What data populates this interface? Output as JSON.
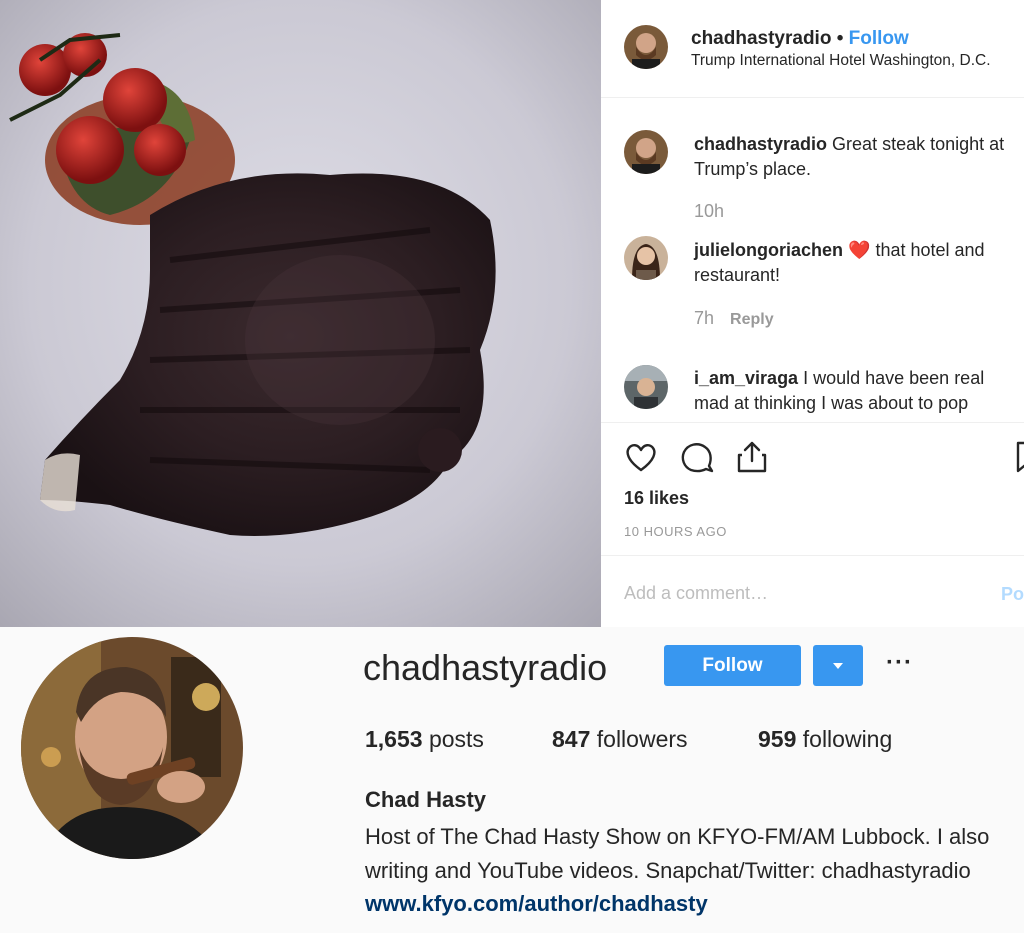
{
  "post": {
    "header": {
      "username": "chadhastyradio",
      "separator": " • ",
      "follow_label": "Follow",
      "location": "Trump International Hotel Washington, D.C."
    },
    "comments": [
      {
        "username": "chadhastyradio",
        "text": " Great steak tonight at Trump’s place.",
        "time": "10h",
        "reply_label": ""
      },
      {
        "username": "julielongoriachen",
        "text": " that hotel and restaurant!",
        "emoji": "❤️",
        "time": "7h",
        "reply_label": "Reply"
      },
      {
        "username": "i_am_viraga",
        "text": " I would have been real mad at thinking I was about to pop",
        "time": "",
        "reply_label": ""
      }
    ],
    "likes": "16 likes",
    "time_ago": "10 HOURS AGO",
    "add_comment_placeholder": "Add a comment…",
    "post_label": "Post",
    "icons": [
      "heart-icon",
      "comment-icon",
      "share-icon",
      "bookmark-icon"
    ]
  },
  "profile": {
    "username": "chadhastyradio",
    "follow_label": "Follow",
    "more_label": "···",
    "stats": {
      "posts_count": "1,653",
      "posts_label": " posts",
      "followers_count": "847",
      "followers_label": " followers",
      "following_count": "959",
      "following_label": " following"
    },
    "full_name": "Chad Hasty",
    "bio_line1": "Host of The Chad Hasty Show on KFYO-FM/AM Lubbock. I also",
    "bio_line2": "writing and YouTube videos. Snapchat/Twitter: chadhastyradio",
    "link": "www.kfyo.com/author/chadhasty"
  },
  "colors": {
    "accent": "#3897f0",
    "link": "#003569",
    "muted": "#999999",
    "heart": "#ed4956"
  }
}
